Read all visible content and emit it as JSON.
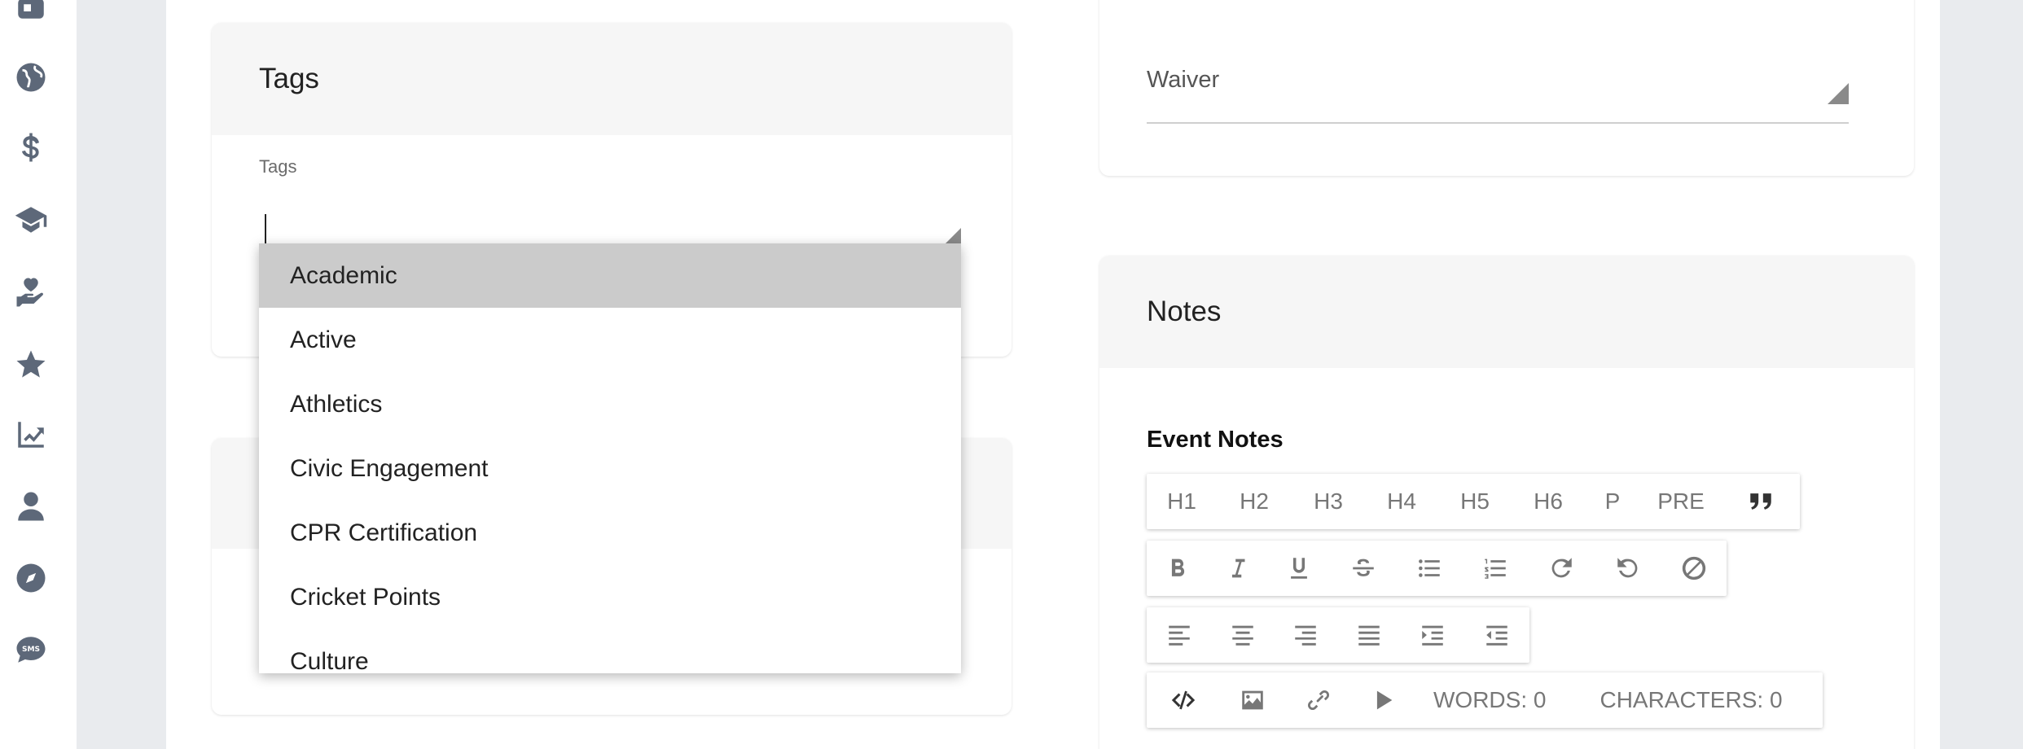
{
  "sidebar": {
    "items": [
      {
        "icon": "square-icon"
      },
      {
        "icon": "globe-icon"
      },
      {
        "icon": "dollar-icon"
      },
      {
        "icon": "graduation-cap-icon"
      },
      {
        "icon": "hand-heart-icon"
      },
      {
        "icon": "star-icon"
      },
      {
        "icon": "chart-line-icon"
      },
      {
        "icon": "user-icon"
      },
      {
        "icon": "compass-icon"
      },
      {
        "icon": "sms-icon"
      }
    ]
  },
  "tags_card": {
    "title": "Tags",
    "field_label": "Tags",
    "input_value": ""
  },
  "tags_dropdown": {
    "options": [
      "Academic",
      "Active",
      "Athletics",
      "Civic Engagement",
      "CPR Certification",
      "Cricket Points",
      "Culture"
    ],
    "highlighted": "Academic"
  },
  "waiver_card": {
    "field_label": "Waiver"
  },
  "notes_card": {
    "title": "Notes",
    "editor_label": "Event Notes",
    "toolbar_row1": [
      "H1",
      "H2",
      "H3",
      "H4",
      "H5",
      "H6",
      "P",
      "PRE"
    ],
    "words_label": "WORDS: 0",
    "characters_label": "CHARACTERS: 0"
  },
  "colors": {
    "accent": "#1f5fc7",
    "sidebar_icon": "#5d6879",
    "highlight": "#cbcbcb"
  }
}
